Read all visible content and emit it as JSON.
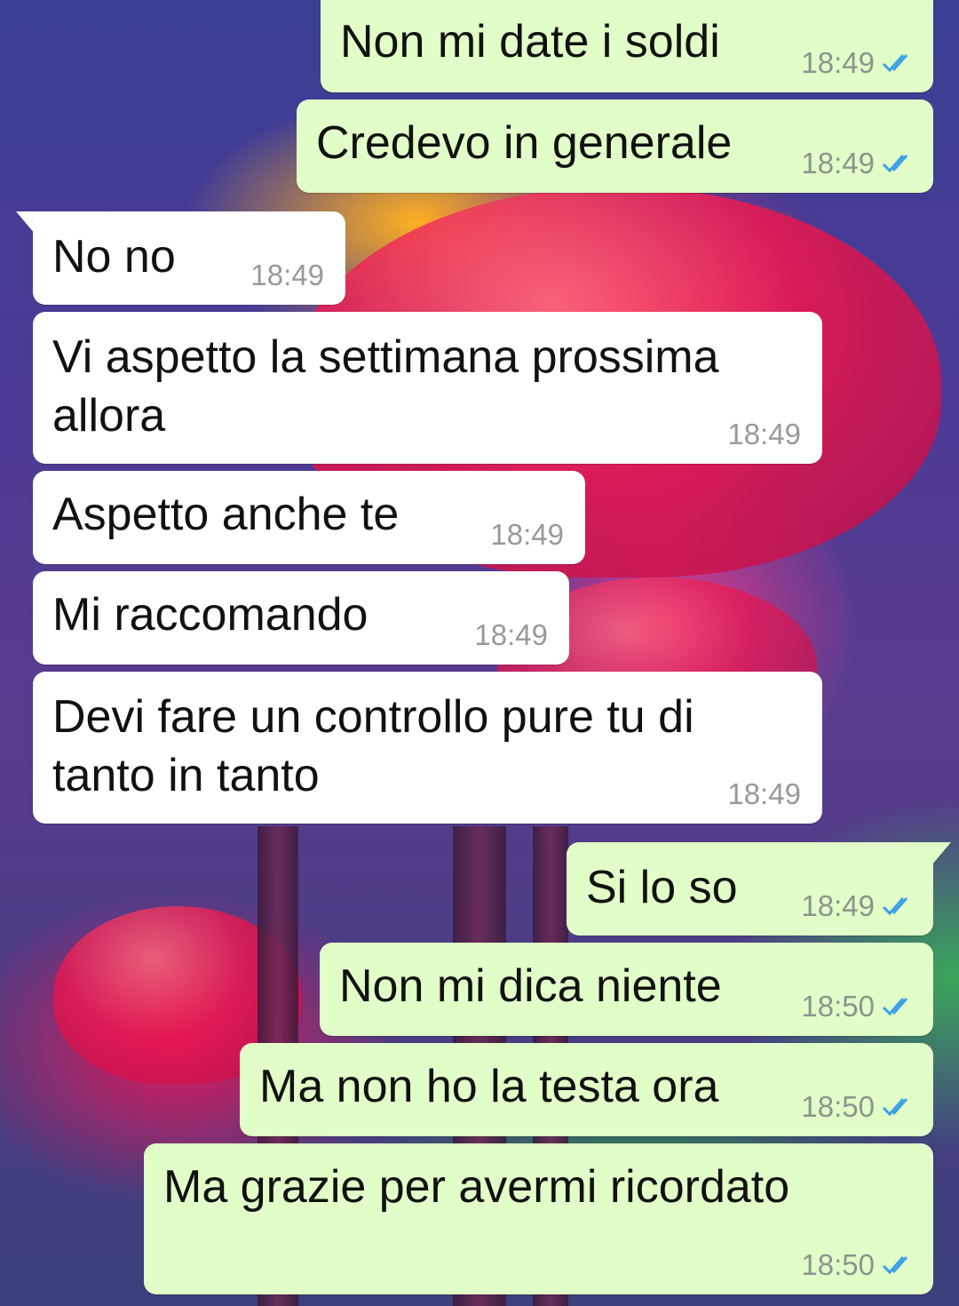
{
  "colors": {
    "outgoing_bubble": "#e2fec8",
    "incoming_bubble": "#ffffff",
    "timestamp": "#8c948c",
    "read_ticks": "#3ba0e6"
  },
  "messages": [
    {
      "direction": "out",
      "text": "Non mi date i soldi",
      "time": "18:49",
      "status": "read"
    },
    {
      "direction": "out",
      "text": "Credevo in generale",
      "time": "18:49",
      "status": "read"
    },
    {
      "direction": "in",
      "text": "No no",
      "time": "18:49"
    },
    {
      "direction": "in",
      "text_lines": [
        "Vi aspetto la settimana prossima",
        "allora"
      ],
      "time": "18:49"
    },
    {
      "direction": "in",
      "text": "Aspetto anche te",
      "time": "18:49"
    },
    {
      "direction": "in",
      "text": "Mi raccomando",
      "time": "18:49"
    },
    {
      "direction": "in",
      "text_lines": [
        "Devi fare un controllo pure tu di",
        "tanto in tanto"
      ],
      "time": "18:49"
    },
    {
      "direction": "out",
      "text": "Si lo so",
      "time": "18:49",
      "status": "read"
    },
    {
      "direction": "out",
      "text": "Non mi dica niente",
      "time": "18:50",
      "status": "read"
    },
    {
      "direction": "out",
      "text": "Ma non ho la testa ora",
      "time": "18:50",
      "status": "read"
    },
    {
      "direction": "out",
      "text": "Ma grazie per avermi ricordato",
      "time": "18:50",
      "status": "read"
    }
  ]
}
